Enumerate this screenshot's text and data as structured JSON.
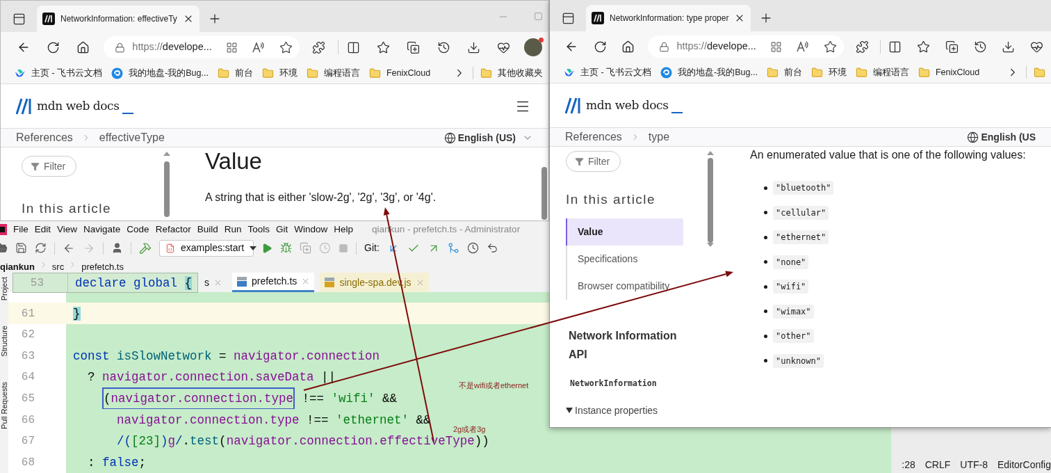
{
  "browser_left": {
    "tab_title": "NetworkInformation: effectiveTy",
    "url_scheme": "https://",
    "url_host": "develope...",
    "bookmarks": [
      {
        "label": "主页 - 飞书云文档",
        "kind": "feishu"
      },
      {
        "label": "我的地盘-我的Bug...",
        "kind": "bug"
      },
      {
        "label": "前台",
        "kind": "folder"
      },
      {
        "label": "环境",
        "kind": "folder"
      },
      {
        "label": "编程语言",
        "kind": "folder"
      },
      {
        "label": "FenixCloud",
        "kind": "folder"
      }
    ],
    "overflow_bookmark": "其他收藏夹",
    "logo_text": "mdn web docs",
    "breadcrumbs": [
      "References",
      "effectiveType"
    ],
    "language": "English (US)",
    "filter_label": "Filter",
    "toc_title": "In this article",
    "heading": "Value",
    "paragraph": "A string that is either 'slow-2g', '2g', '3g', or '4g'."
  },
  "ide": {
    "menu": [
      "File",
      "Edit",
      "View",
      "Navigate",
      "Code",
      "Refactor",
      "Build",
      "Run",
      "Tools",
      "Git",
      "Window",
      "Help"
    ],
    "title": "qiankun - prefetch.ts - Administrator",
    "run_config": "examples:start",
    "git_label": "Git:",
    "breadcrumbs": [
      "qiankun",
      "src",
      "prefetch.ts"
    ],
    "tabs": [
      {
        "label": "s",
        "kind": "plain",
        "selected": false
      },
      {
        "label": "prefetch.ts",
        "kind": "ts",
        "selected": true
      },
      {
        "label": "single-spa.dev.js",
        "kind": "js",
        "selected": false
      }
    ],
    "side_tabs": [
      "Project",
      "Structure",
      "Pull Requests"
    ],
    "sticky": {
      "number": "53",
      "tokens": [
        {
          "text": "declare global ",
          "kind": "keyword"
        },
        {
          "text": "{",
          "kind": "plain",
          "matched": true
        }
      ]
    },
    "lines": [
      {
        "number": "61",
        "current": true,
        "highlighted": false,
        "tokens": [
          {
            "text": "}",
            "kind": "plain",
            "matched": true
          }
        ]
      },
      {
        "number": "62",
        "current": false,
        "highlighted": true
      },
      {
        "number": "63",
        "current": false,
        "highlighted": true,
        "tokens": [
          {
            "text": "const ",
            "kind": "keyword"
          },
          {
            "text": "isSlowNetwork",
            "kind": "ident"
          },
          {
            "text": " = ",
            "kind": "plain"
          },
          {
            "text": "navigator.connection",
            "kind": "field"
          }
        ]
      },
      {
        "number": "64",
        "current": false,
        "highlighted": true,
        "tokens": [
          {
            "text": "  ? ",
            "kind": "plain"
          },
          {
            "text": "navigator.connection.saveData",
            "kind": "field"
          },
          {
            "text": " ||",
            "kind": "plain"
          }
        ]
      },
      {
        "number": "65",
        "current": false,
        "highlighted": true,
        "tokens": [
          {
            "text": "    (",
            "kind": "plain",
            "boxed": true
          },
          {
            "text": "navigator.connection.type",
            "kind": "field",
            "boxed": true
          },
          {
            "text": " !== ",
            "kind": "plain"
          },
          {
            "text": "'wifi'",
            "kind": "string"
          },
          {
            "text": " &&",
            "kind": "plain"
          }
        ]
      },
      {
        "number": "66",
        "current": false,
        "highlighted": true,
        "tokens": [
          {
            "text": "      navigator.connection.type",
            "kind": "field"
          },
          {
            "text": " !== ",
            "kind": "plain"
          },
          {
            "text": "'ethernet'",
            "kind": "string"
          },
          {
            "text": " &&",
            "kind": "plain"
          }
        ]
      },
      {
        "number": "67",
        "current": false,
        "highlighted": true,
        "tokens": [
          {
            "text": "      /(",
            "kind": "regex"
          },
          {
            "text": "[23]",
            "kind": "string"
          },
          {
            "text": ")",
            "kind": "regex"
          },
          {
            "text": "g",
            "kind": "field"
          },
          {
            "text": "/",
            "kind": "regex"
          },
          {
            "text": ".",
            "kind": "plain"
          },
          {
            "text": "test",
            "kind": "ident"
          },
          {
            "text": "(",
            "kind": "plain"
          },
          {
            "text": "navigator.connection.effectiveType",
            "kind": "field"
          },
          {
            "text": "))",
            "kind": "plain"
          }
        ]
      },
      {
        "number": "68",
        "current": false,
        "highlighted": true,
        "tokens": [
          {
            "text": "  : ",
            "kind": "plain"
          },
          {
            "text": "false",
            "kind": "keyword"
          },
          {
            "text": ";",
            "kind": "plain"
          }
        ]
      }
    ],
    "status": [
      ":28",
      "CRLF",
      "UTF-8",
      "EditorConfig"
    ]
  },
  "browser_right": {
    "tab_title": "NetworkInformation: type proper",
    "url_scheme": "https://",
    "url_host": "develope...",
    "bookmarks": [
      {
        "label": "主页 - 飞书云文档",
        "kind": "feishu"
      },
      {
        "label": "我的地盘-我的Bug...",
        "kind": "bug"
      },
      {
        "label": "前台",
        "kind": "folder"
      },
      {
        "label": "环境",
        "kind": "folder"
      },
      {
        "label": "编程语言",
        "kind": "folder"
      },
      {
        "label": "FenixCloud",
        "kind": "folder"
      }
    ],
    "logo_text": "mdn web docs",
    "breadcrumbs": [
      "References",
      "type"
    ],
    "language": "English (US",
    "filter_label": "Filter",
    "toc_title": "In this article",
    "toc": [
      {
        "label": "Value",
        "selected": true
      },
      {
        "label": "Specifications",
        "selected": false
      },
      {
        "label": "Browser compatibility",
        "selected": false
      }
    ],
    "api_heading": "Network Information API",
    "interface": "NetworkInformation",
    "section": "Instance properties",
    "section_expanded": true,
    "intro": "An enumerated value that is one of the following values:",
    "values": [
      "\"bluetooth\"",
      "\"cellular\"",
      "\"ethernet\"",
      "\"none\"",
      "\"wifi\"",
      "\"wimax\"",
      "\"other\"",
      "\"unknown\""
    ]
  },
  "notes": [
    {
      "text": "不是wifi或者ethernet"
    },
    {
      "text": "2g或者3g"
    }
  ]
}
